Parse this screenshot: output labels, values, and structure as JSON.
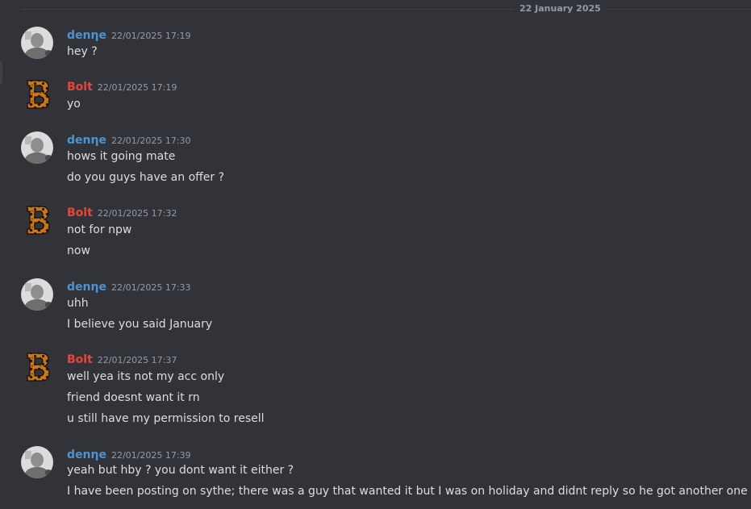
{
  "divider": {
    "date": "22 January 2025"
  },
  "users": {
    "denne": {
      "name": "denηe",
      "color": "#4a95d6",
      "avatar_icon": "grey-photo-avatar-icon"
    },
    "bolt": {
      "name": "Bolt",
      "color": "#e0483f",
      "avatar_icon": "leopard-b-logo-icon"
    }
  },
  "messages": [
    {
      "author": "denηe",
      "time": "22/01/2025 17:19",
      "lines": [
        "hey ?"
      ]
    },
    {
      "author": "Bolt",
      "time": "22/01/2025 17:19",
      "lines": [
        "yo"
      ]
    },
    {
      "author": "denηe",
      "time": "22/01/2025 17:30",
      "lines": [
        "hows it going mate",
        "do you guys have an offer ?"
      ]
    },
    {
      "author": "Bolt",
      "time": "22/01/2025 17:32",
      "lines": [
        "not for npw",
        "now"
      ]
    },
    {
      "author": "denηe",
      "time": "22/01/2025 17:33",
      "lines": [
        "uhh",
        "I believe you said January"
      ]
    },
    {
      "author": "Bolt",
      "time": "22/01/2025 17:37",
      "lines": [
        "well yea its not my acc only",
        "friend doesnt want it rn",
        "u still have my permission to resell"
      ]
    },
    {
      "author": "denηe",
      "time": "22/01/2025 17:39",
      "lines": [
        "yeah but hby ? you dont want it either ?",
        "I have been posting on sythe; there was a guy that wanted it but I was on holiday and didnt reply so he got another one"
      ]
    }
  ]
}
